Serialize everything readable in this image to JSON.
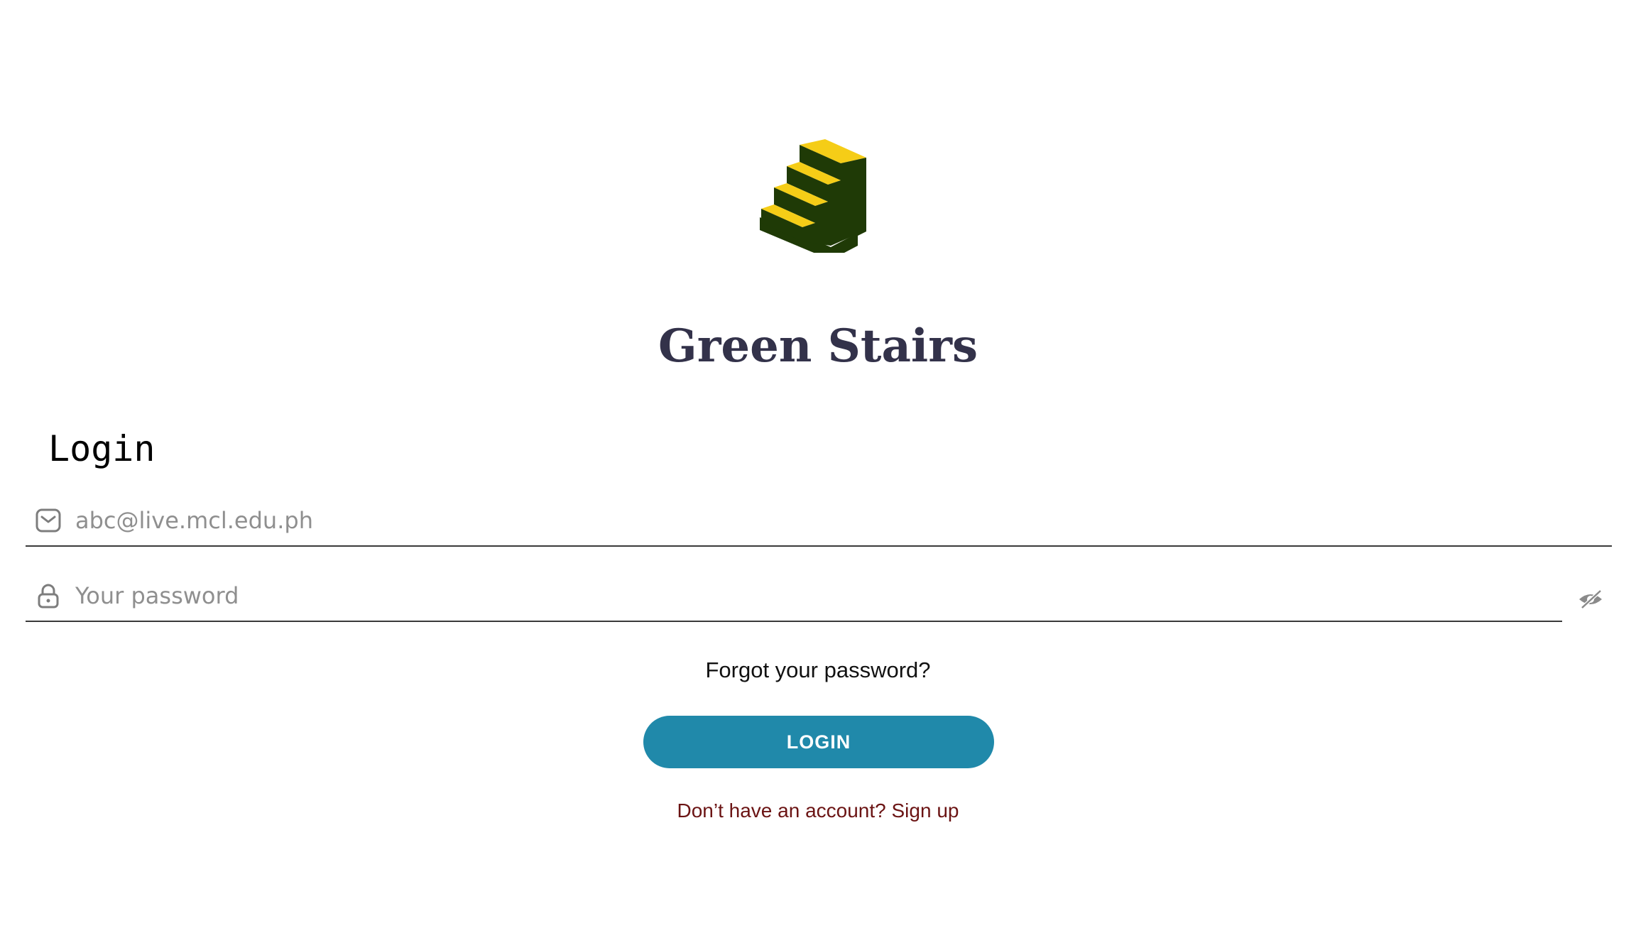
{
  "app": {
    "title": "Green Stairs",
    "logo_icon": "stairs-logo",
    "colors": {
      "stair_top": "#f5cd17",
      "stair_body": "#1f3a06",
      "title_text": "#33324a",
      "button_bg": "#2089aa",
      "signup_text": "#6b1414"
    }
  },
  "login": {
    "heading": "Login",
    "email": {
      "value": "",
      "placeholder": "abc@live.mcl.edu.ph",
      "icon": "mail-icon"
    },
    "password": {
      "value": "",
      "placeholder": "Your password",
      "icon": "lock-icon",
      "toggle_icon": "eye-off-icon"
    },
    "forgot_label": "Forgot your password?",
    "button_label": "LOGIN",
    "signup_label": "Don’t have an account? Sign up"
  }
}
